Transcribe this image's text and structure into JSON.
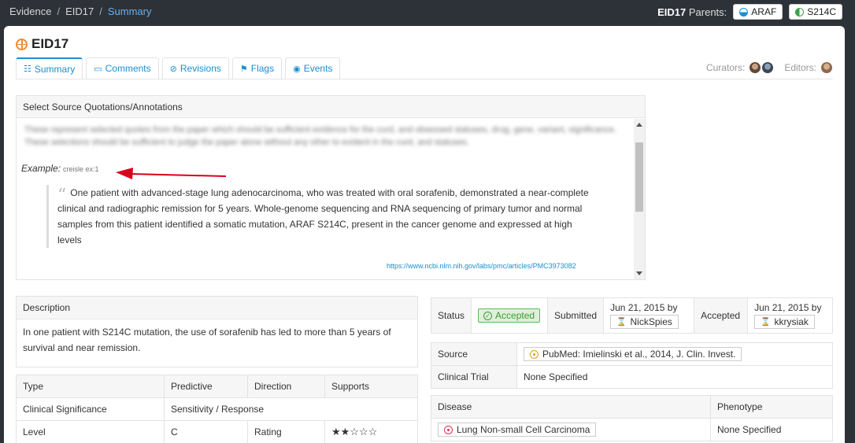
{
  "breadcrumb": {
    "items": [
      "Evidence",
      "EID17"
    ],
    "current": "Summary"
  },
  "parents": {
    "id": "EID17",
    "label": "Parents:",
    "items": [
      "ARAF",
      "S214C"
    ]
  },
  "page": {
    "title": "EID17"
  },
  "tabs": [
    "Summary",
    "Comments",
    "Revisions",
    "Flags",
    "Events"
  ],
  "people": {
    "curators_label": "Curators:",
    "editors_label": "Editors:"
  },
  "quotations": {
    "header": "Select Source Quotations/Annotations",
    "blurred_text": "These represent selected quotes from the paper which should be sufficient evidence for the curd, and obsessed statuses, drug, gene, variant, significance. These selections should be sufficient to judge the paper alone without any other to evident in the curd, and statuses.",
    "example_label": "Example:",
    "example_note": "creisle ex:1",
    "quote": "One patient with advanced-stage lung adenocarcinoma, who was treated with oral sorafenib, demonstrated a near-complete clinical and radiographic remission for 5 years. Whole-genome sequencing and RNA sequencing of primary tumor and normal samples from this patient identified a somatic mutation, ARAF S214C, present in the cancer genome and expressed at high levels",
    "link": "https://www.ncbi.nlm.nih.gov/labs/pmc/articles/PMC3973082"
  },
  "description": {
    "header": "Description",
    "text": "In one patient with S214C mutation, the use of sorafenib has led to more than 5 years of survival and near remission."
  },
  "attributes": {
    "type_label": "Type",
    "type_value": "Predictive",
    "direction_label": "Direction",
    "direction_value": "Supports",
    "significance_label": "Clinical Significance",
    "significance_value": "Sensitivity / Response",
    "level_label": "Level",
    "level_value": "C",
    "rating_label": "Rating",
    "rating_stars": "★★☆☆☆",
    "rating": 2
  },
  "status": {
    "status_label": "Status",
    "status_value": "Accepted",
    "submitted_label": "Submitted",
    "submitted_date": "Jun 21, 2015 by",
    "submitted_user": "NickSpies",
    "accepted_label": "Accepted",
    "accepted_date": "Jun 21, 2015 by",
    "accepted_user": "kkrysiak"
  },
  "source": {
    "source_label": "Source",
    "source_value": "PubMed: Imielinski et al., 2014, J. Clin. Invest.",
    "trial_label": "Clinical Trial",
    "trial_value": "None Specified"
  },
  "disease": {
    "disease_label": "Disease",
    "phenotype_label": "Phenotype",
    "disease_value": "Lung Non-small Cell Carcinoma",
    "phenotype_value": "None Specified"
  },
  "colors": {
    "link": "#1a8fd1",
    "accepted": "#5cb85c",
    "evidence_icon": "#f08a32",
    "arrow": "#d9001b"
  }
}
